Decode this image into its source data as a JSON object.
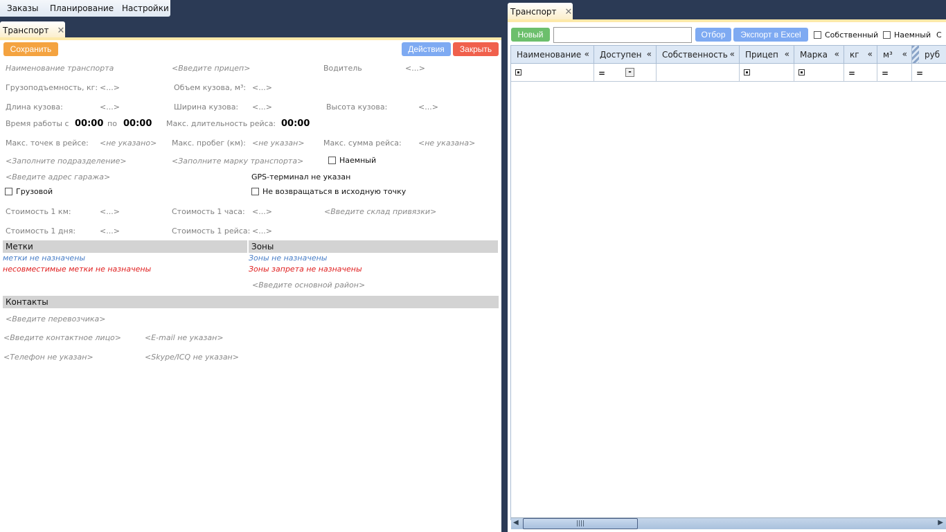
{
  "menu": {
    "items": [
      "Заказы",
      "Планирование",
      "Настройки"
    ]
  },
  "left": {
    "tab": "Транспорт",
    "save": "Сохранить",
    "actions": "Действия",
    "close": "Закрыть",
    "name_ph": "Наименование транспорта",
    "trailer_ph": "<Введите прицеп>",
    "driver_lbl": "Водитель",
    "driver_val": "<...>",
    "capacity_lbl": "Грузоподъемность, кг:",
    "capacity_val": "<...>",
    "volume_lbl": "Объем кузова, м³:",
    "volume_val": "<...>",
    "length_lbl": "Длина кузова:",
    "length_val": "<...>",
    "width_lbl": "Ширина кузова:",
    "width_val": "<...>",
    "height_lbl": "Высота кузова:",
    "height_val": "<...>",
    "work_lbl": "Время работы с",
    "work_from": "00:00",
    "work_to_lbl": "по",
    "work_to": "00:00",
    "maxdur_lbl": "Макс. длительность рейса:",
    "maxdur_val": "00:00",
    "maxpts_lbl": "Макс. точек в рейсе:",
    "maxpts_val": "<не указано>",
    "maxrun_lbl": "Макс. пробег (км):",
    "maxrun_val": "<не указан>",
    "maxsum_lbl": "Макс. сумма рейса:",
    "maxsum_val": "<не указана>",
    "dept_ph": "<Заполните подразделение>",
    "brand_ph": "<Заполните марку транспорта>",
    "hired_lbl": "Наемный",
    "garage_ph": "<Введите адрес гаража>",
    "gps": "GPS-терминал не указан",
    "cargo_lbl": "Грузовой",
    "noreturn_lbl": "Не возвращаться в исходную точку",
    "costkm_lbl": "Стоимость 1 км:",
    "costkm_val": "<...>",
    "costh_lbl": "Стоимость 1 часа:",
    "costh_val": "<...>",
    "wh_ph": "<Введите склад привязки>",
    "costday_lbl": "Стоимость 1 дня:",
    "costday_val": "<...>",
    "costtrip_lbl": "Стоимость 1 рейса:",
    "costtrip_val": "<...>",
    "tags_title": "Метки",
    "tags_none": "метки не назначены",
    "tags_incomp": "несовместимые метки не назначены",
    "zones_title": "Зоны",
    "zones_none": "Зоны не назначены",
    "zones_forbid": "Зоны запрета не назначены",
    "district_ph": "<Введите основной район>",
    "contacts_title": "Контакты",
    "carrier_ph": "<Введите перевозчика>",
    "contact_ph": "<Введите контактное лицо>",
    "email_ph": "<E-mail не указан>",
    "phone_ph": "<Телефон не указан>",
    "skype_ph": "<Skype/ICQ не указан>"
  },
  "right": {
    "tab": "Транспорт",
    "new": "Новый",
    "search_value": "",
    "filter": "Отбор",
    "export": "Экспорт в Excel",
    "own_lbl": "Собственный",
    "hired_lbl": "Наемный",
    "cut_lbl": "С",
    "columns": [
      "Наименование",
      "Доступен",
      "Собственность",
      "Прицеп",
      "Марка",
      "кг",
      "м³",
      "руб"
    ]
  },
  "colors": {
    "save": "#f4a340",
    "actions": "#7eaaf2",
    "close": "#f0604c",
    "new": "#6cbf6c",
    "header_bg": "#2b3a55"
  }
}
